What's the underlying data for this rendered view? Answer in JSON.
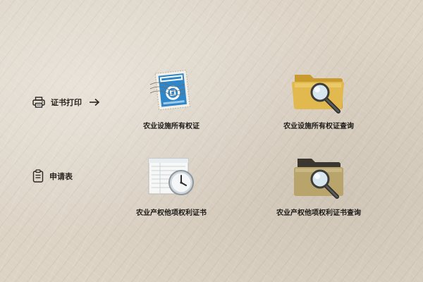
{
  "sidebar": {
    "print": {
      "label": "证书打印",
      "icon": "printer-icon"
    },
    "application": {
      "label": "申请表",
      "icon": "clipboard-icon"
    }
  },
  "tiles": {
    "facility_cert": {
      "caption": "农业设施所有权证",
      "icon": "stamp-icon"
    },
    "facility_query": {
      "caption": "农业设施所有权证查询",
      "icon": "folder-search-icon"
    },
    "rights_cert": {
      "caption": "农业产权他项权利证书",
      "icon": "document-clock-icon"
    },
    "rights_query": {
      "caption": "农业产权他项权利证书查询",
      "icon": "folder-search-icon"
    }
  },
  "colors": {
    "background": "#dcd3c5",
    "stamp_blue": "#2f86c8",
    "folder_gold": "#e2b94e",
    "folder_khaki": "#b9a46c"
  }
}
